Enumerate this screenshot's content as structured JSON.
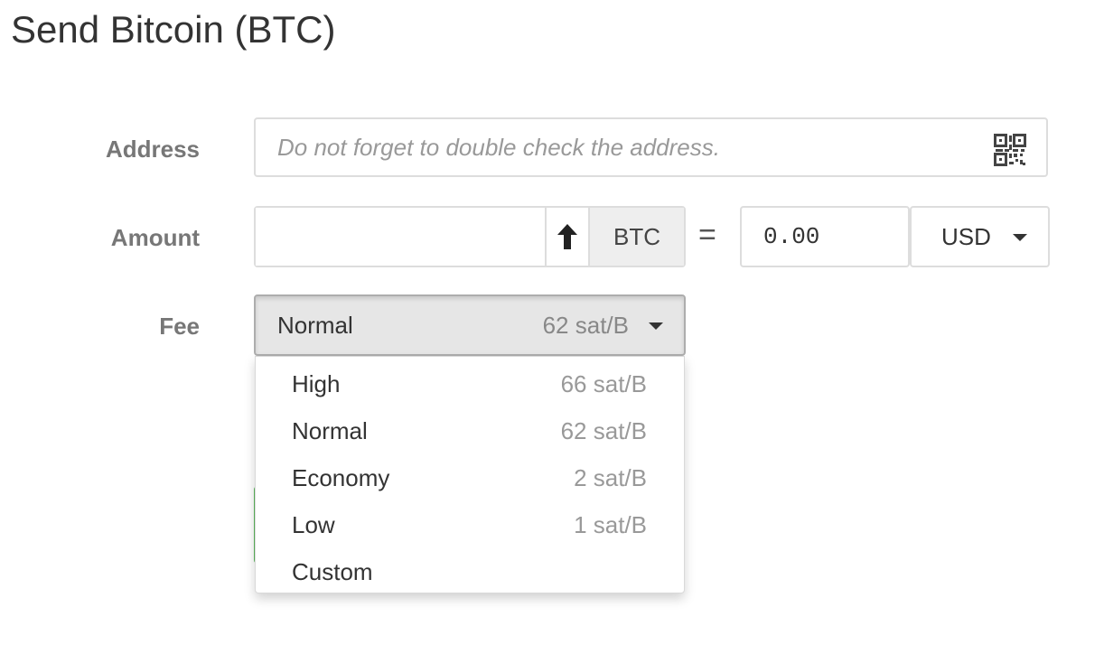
{
  "title": "Send Bitcoin (BTC)",
  "address": {
    "label": "Address",
    "value": "",
    "placeholder": "Do not forget to double check the address.",
    "scan_icon": "qr-code-icon"
  },
  "amount": {
    "label": "Amount",
    "value": "",
    "max_icon": "arrow-up-icon",
    "currency": "BTC",
    "equals": "=",
    "fiat_value": "0.00",
    "fiat_currency": "USD"
  },
  "fee": {
    "label": "Fee",
    "selected_label": "Normal",
    "selected_rate": "62 sat/B",
    "options": [
      {
        "label": "High",
        "rate": "66 sat/B"
      },
      {
        "label": "Normal",
        "rate": "62 sat/B"
      },
      {
        "label": "Economy",
        "rate": "2 sat/B"
      },
      {
        "label": "Low",
        "rate": "1 sat/B"
      },
      {
        "label": "Custom",
        "rate": ""
      }
    ]
  },
  "colors": {
    "label_gray": "#777777",
    "input_border": "#dddddd",
    "addon_bg": "#eeeeee",
    "selected_select_bg": "#e6e6e6",
    "success_green": "#5cb85c"
  }
}
